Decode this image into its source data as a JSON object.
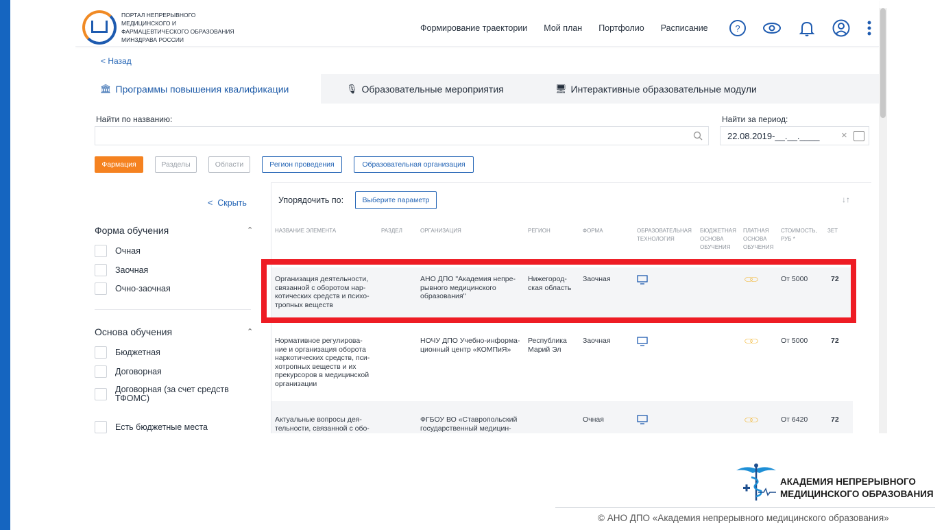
{
  "header": {
    "logo_text": "ПОРТАЛ НЕПРЕРЫВНОГО МЕДИЦИНСКОГО И ФАРМАЦЕВТИЧЕСКОГО ОБРАЗОВАНИЯ МИНЗДРАВА РОССИИ",
    "nav": [
      "Формирование траектории",
      "Мой план",
      "Портфолио",
      "Расписание"
    ],
    "icons": [
      "help-icon",
      "eye-icon",
      "bell-icon",
      "user-icon",
      "more-icon"
    ]
  },
  "back_label": "< Назад",
  "tabs": [
    {
      "label": "Программы повышения квалификации",
      "icon": "building-icon",
      "active": true
    },
    {
      "label": "Образовательные мероприятия",
      "icon": "microphone-icon",
      "active": false
    },
    {
      "label": "Интерактивные образовательные модули",
      "icon": "monitor-icon",
      "active": false
    }
  ],
  "search": {
    "label": "Найти по названию:",
    "value": ""
  },
  "period": {
    "label": "Найти за период:",
    "value": "22.08.2019-__.__.____"
  },
  "chips": [
    "Фармация",
    "Разделы",
    "Области",
    "Регион проведения",
    "Образовательная организация"
  ],
  "sidebar": {
    "hide_label": "Скрыть",
    "form": {
      "title": "Форма обучения",
      "options": [
        "Очная",
        "Заочная",
        "Очно-заочная"
      ]
    },
    "basis": {
      "title": "Основа обучения",
      "options": [
        "Бюджетная",
        "Договорная",
        "Договорная (за счет средств ТФОМС)"
      ]
    },
    "budget_places": "Есть бюджетные места"
  },
  "sort": {
    "label": "Упорядочить по:",
    "button": "Выберите параметр"
  },
  "columns": [
    "Название элемента",
    "Раздел",
    "Организация",
    "Регион",
    "Форма",
    "Образовательная технология",
    "Бюджетная основа обучения",
    "Платная основа обучения",
    "Стоимость, руб *",
    "ЗЕТ"
  ],
  "rows": [
    {
      "title": "Организация деятельности, связанной с оборотом нар-котических средств и психо-тропных веществ",
      "org": "АНО ДПО \"Академия непре-рывного медицинского образования\"",
      "region": "Нижегород-ская область",
      "form": "Заочная",
      "cost": "От 5000",
      "zet": "72"
    },
    {
      "title": "Нормативное регулирова-ние и организация оборота наркотических средств, пси-хотропных веществ и их прекурсоров в медицинской организации",
      "org": "НОЧУ ДПО Учебно-информа-ционный центр «КОМПиЯ»",
      "region": "Республика Марий Эл",
      "form": "Заочная",
      "cost": "От 5000",
      "zet": "72"
    },
    {
      "title": "Актуальные вопросы дея-тельности, связанной с обо-",
      "org": "ФГБОУ ВО «Ставропольский государственный медицин-",
      "region": "",
      "form": "Очная",
      "cost": "От 6420",
      "zet": "72"
    }
  ],
  "branding": {
    "name_line1": "АКАДЕМИЯ НЕПРЕРЫВНОГО",
    "name_line2": "МЕДИЦИНСКОГО ОБРАЗОВАНИЯ",
    "copyright": "© АНО ДПО «Академия непрерывного медицинского образования»"
  },
  "colors": {
    "accent": "#2364b5",
    "orange": "#f58220",
    "highlight": "#ee1c24",
    "side_bar": "#1565c0"
  }
}
